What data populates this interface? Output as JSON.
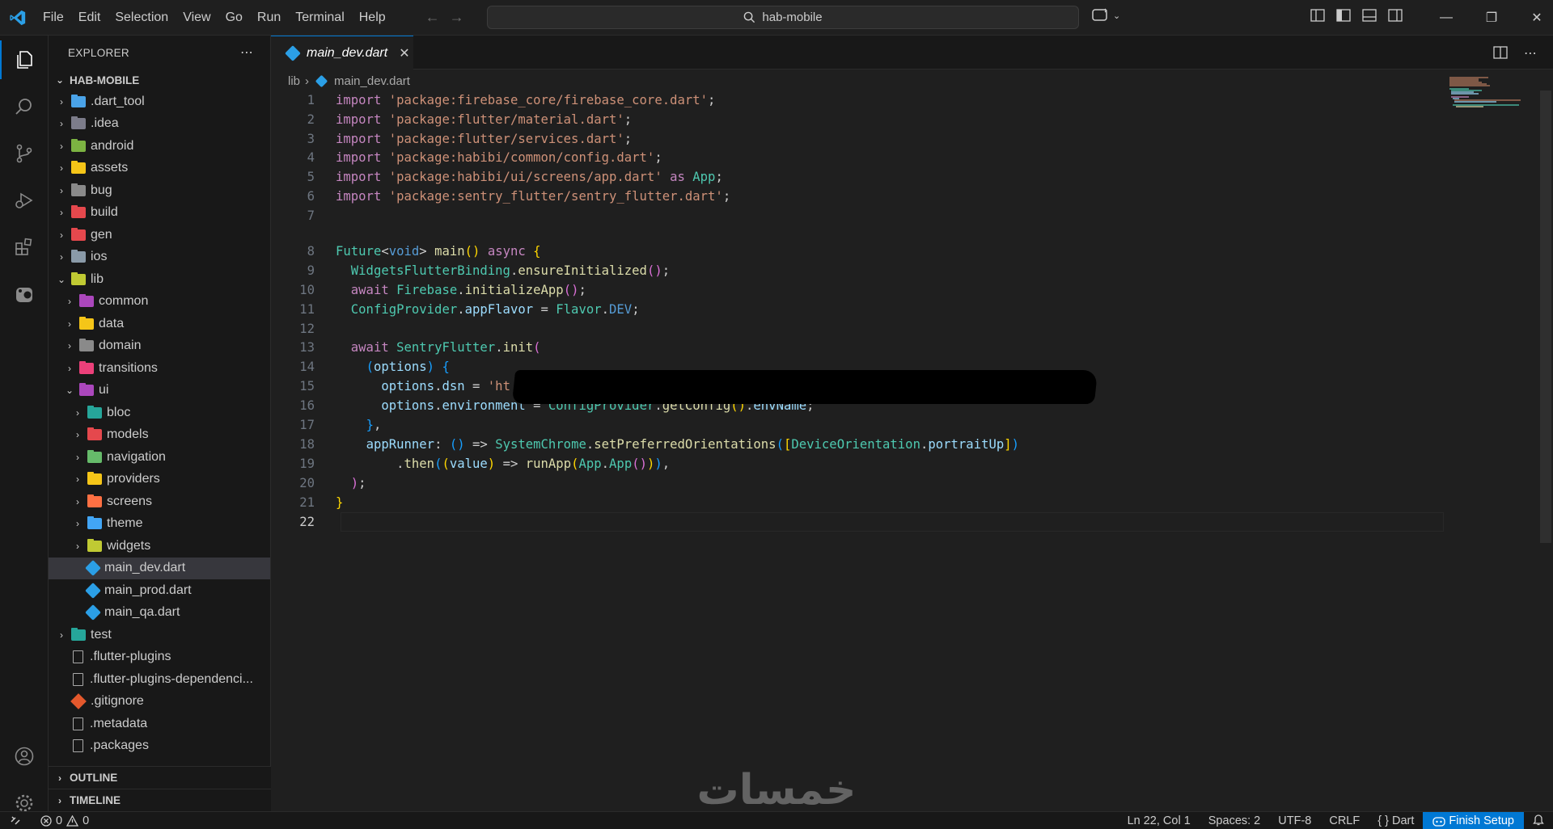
{
  "menu": [
    "File",
    "Edit",
    "Selection",
    "View",
    "Go",
    "Run",
    "Terminal",
    "Help"
  ],
  "search": {
    "text": "hab-mobile"
  },
  "sidebar": {
    "header": "EXPLORER",
    "project": "HAB-MOBILE",
    "items": [
      {
        "label": ".dart_tool",
        "type": "folder",
        "depth": 0,
        "color": "#4aa3e8"
      },
      {
        "label": ".idea",
        "type": "folder",
        "depth": 0,
        "color": "#7c7c8a"
      },
      {
        "label": "android",
        "type": "folder",
        "depth": 0,
        "color": "#7cb342"
      },
      {
        "label": "assets",
        "type": "folder",
        "depth": 0,
        "color": "#f5c518"
      },
      {
        "label": "bug",
        "type": "folder",
        "depth": 0,
        "color": "#8a8a8a"
      },
      {
        "label": "build",
        "type": "folder",
        "depth": 0,
        "color": "#e5484d"
      },
      {
        "label": "gen",
        "type": "folder",
        "depth": 0,
        "color": "#e5484d"
      },
      {
        "label": "ios",
        "type": "folder",
        "depth": 0,
        "color": "#8a9aa8"
      },
      {
        "label": "lib",
        "type": "folder-open",
        "depth": 0,
        "color": "#c0ca33"
      },
      {
        "label": "common",
        "type": "folder",
        "depth": 1,
        "color": "#ab47bc"
      },
      {
        "label": "data",
        "type": "folder",
        "depth": 1,
        "color": "#f5c518"
      },
      {
        "label": "domain",
        "type": "folder",
        "depth": 1,
        "color": "#8a8a8a"
      },
      {
        "label": "transitions",
        "type": "folder",
        "depth": 1,
        "color": "#ec407a"
      },
      {
        "label": "ui",
        "type": "folder-open",
        "depth": 1,
        "color": "#ab47bc"
      },
      {
        "label": "bloc",
        "type": "folder",
        "depth": 2,
        "color": "#26a69a"
      },
      {
        "label": "models",
        "type": "folder",
        "depth": 2,
        "color": "#e5484d"
      },
      {
        "label": "navigation",
        "type": "folder",
        "depth": 2,
        "color": "#66bb6a"
      },
      {
        "label": "providers",
        "type": "folder",
        "depth": 2,
        "color": "#f5c518"
      },
      {
        "label": "screens",
        "type": "folder",
        "depth": 2,
        "color": "#ff7043"
      },
      {
        "label": "theme",
        "type": "folder",
        "depth": 2,
        "color": "#42a5f5"
      },
      {
        "label": "widgets",
        "type": "folder",
        "depth": 2,
        "color": "#c0ca33"
      },
      {
        "label": "main_dev.dart",
        "type": "dart",
        "depth": 2,
        "selected": true
      },
      {
        "label": "main_prod.dart",
        "type": "dart",
        "depth": 2
      },
      {
        "label": "main_qa.dart",
        "type": "dart",
        "depth": 2
      },
      {
        "label": "test",
        "type": "folder",
        "depth": 0,
        "color": "#26a69a"
      },
      {
        "label": ".flutter-plugins",
        "type": "file",
        "depth": 0
      },
      {
        "label": ".flutter-plugins-dependenci...",
        "type": "file",
        "depth": 0
      },
      {
        "label": ".gitignore",
        "type": "git",
        "depth": 0
      },
      {
        "label": ".metadata",
        "type": "file",
        "depth": 0
      },
      {
        "label": ".packages",
        "type": "file",
        "depth": 0
      }
    ],
    "outline": "OUTLINE",
    "timeline": "TIMELINE"
  },
  "editor": {
    "tab": "main_dev.dart",
    "breadcrumb": {
      "folder": "lib",
      "file": "main_dev.dart"
    },
    "current_line": 22
  },
  "status": {
    "errors": "0",
    "warnings": "0",
    "position": "Ln 22, Col 1",
    "spaces": "Spaces: 2",
    "encoding": "UTF-8",
    "eol": "CRLF",
    "language": "Dart",
    "finish_setup": "Finish Setup"
  },
  "watermark": "خمسات",
  "colors": {
    "accent": "#0078d4",
    "background": "#1f1f1f",
    "sidebar": "#181818"
  }
}
